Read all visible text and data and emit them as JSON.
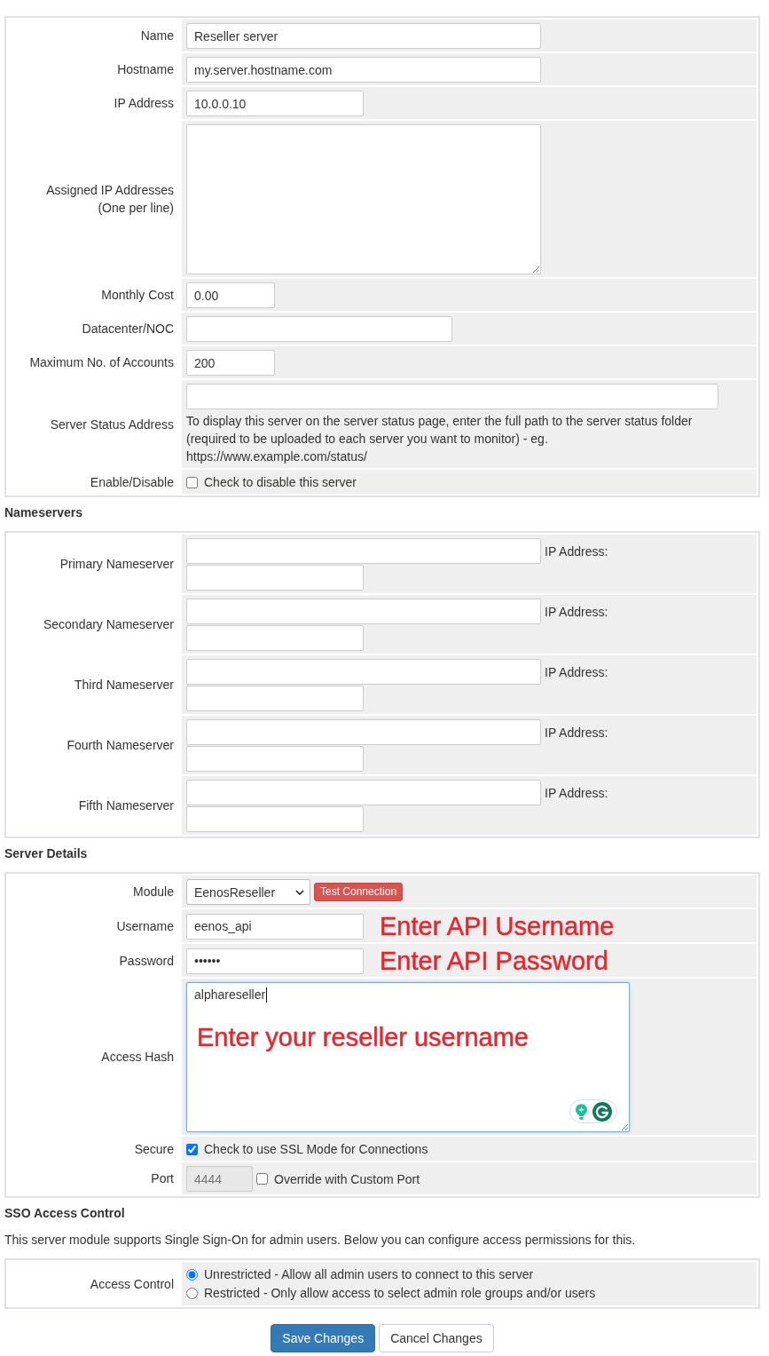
{
  "server": {
    "rows": [
      {
        "kind": "input",
        "label": "Name",
        "value": "Reseller server"
      },
      {
        "kind": "input",
        "label": "Hostname",
        "value": "my.server.hostname.com"
      },
      {
        "kind": "input",
        "label": "IP Address",
        "value": "10.0.0.10"
      },
      {
        "kind": "textarea",
        "label": "Assigned IP Addresses",
        "note": "(One per line)"
      },
      {
        "kind": "input",
        "label": "Monthly Cost",
        "value": "0.00"
      },
      {
        "kind": "input",
        "label": "Datacenter/NOC"
      },
      {
        "kind": "input",
        "label": "Maximum No. of Accounts",
        "value": "200"
      },
      {
        "kind": "input",
        "label": "Server Status Address",
        "help": "To display this server on the server status page, enter the full path to the server status folder (required to be uploaded to each server you want to monitor) - eg. https://www.example.com/status/"
      },
      {
        "kind": "checkbox",
        "label": "Enable/Disable",
        "text": "Check to disable this server",
        "checked": false
      }
    ]
  },
  "nameservers": {
    "heading": "Nameservers",
    "rows": [
      {
        "kind": "nameserver",
        "label": "Primary Nameserver",
        "ip_label": "IP Address:"
      },
      {
        "kind": "nameserver",
        "label": "Secondary Nameserver",
        "ip_label": "IP Address:"
      },
      {
        "kind": "nameserver",
        "label": "Third Nameserver",
        "ip_label": "IP Address:"
      },
      {
        "kind": "nameserver",
        "label": "Fourth Nameserver",
        "ip_label": "IP Address:"
      },
      {
        "kind": "nameserver",
        "label": "Fifth Nameserver",
        "ip_label": "IP Address:"
      }
    ]
  },
  "server_details": {
    "heading": "Server Details",
    "rows": [
      {
        "kind": "select",
        "label": "Module",
        "value": "EenosReseller",
        "button": "Test Connection"
      },
      {
        "kind": "input",
        "label": "Username",
        "value": "eenos_api",
        "annotation": "Enter API Username"
      },
      {
        "kind": "password",
        "label": "Password",
        "value": "••••••",
        "annotation": "Enter API Password"
      },
      {
        "kind": "textarea",
        "label": "Access Hash",
        "value": "alphareseller",
        "focused": true,
        "annotation": "Enter your reseller username"
      },
      {
        "kind": "checkbox",
        "label": "Secure",
        "text": "Check to use SSL Mode for Connections",
        "checked": true
      },
      {
        "kind": "port",
        "label": "Port",
        "value": "4444",
        "disabled": true,
        "text": "Override with Custom Port",
        "checked": false
      }
    ]
  },
  "sso": {
    "heading": "SSO Access Control",
    "description": "This server module supports Single Sign-On for admin users. Below you can configure access permissions for this.",
    "rows": [
      {
        "kind": "radio",
        "label": "Access Control",
        "options": [
          {
            "text": "Unrestricted - Allow all admin users to connect to this server",
            "selected": true
          },
          {
            "text": "Restricted - Only allow access to select admin role groups and/or users",
            "selected": false
          }
        ]
      }
    ]
  },
  "buttons": [
    {
      "kind": "primary",
      "label": "Save Changes"
    },
    {
      "kind": "default",
      "label": "Cancel Changes"
    }
  ]
}
